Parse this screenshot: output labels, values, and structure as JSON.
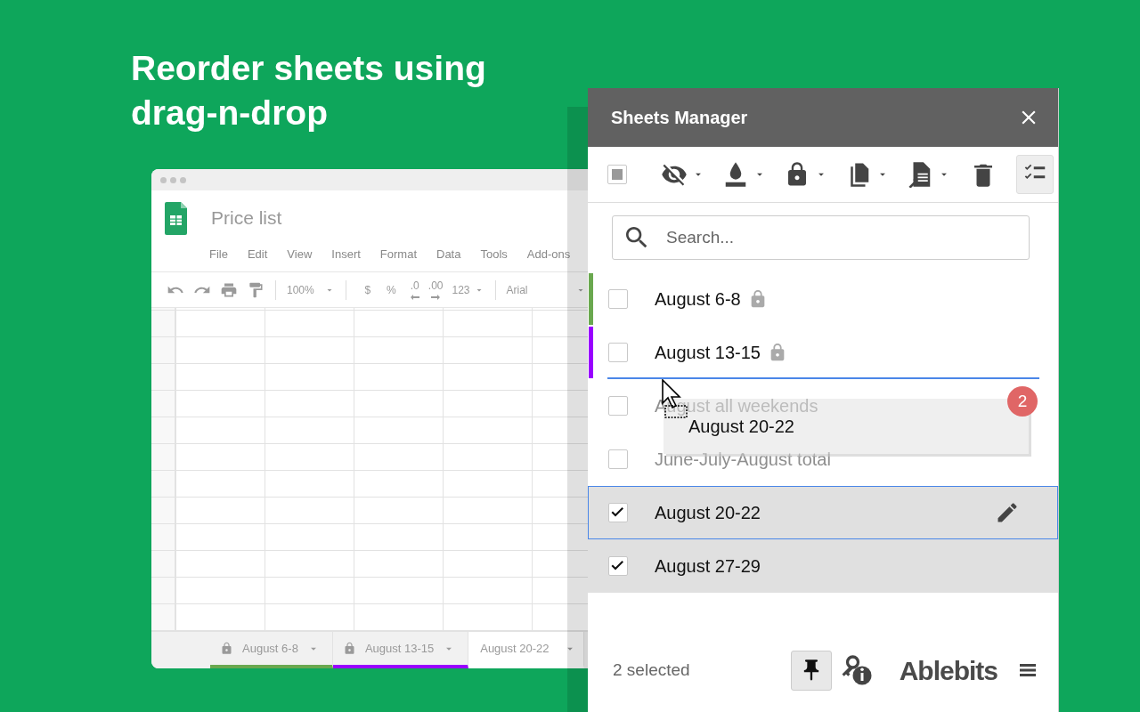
{
  "headline": "Reorder sheets using drag-n-drop",
  "spreadsheet": {
    "title": "Price list",
    "menu": [
      "File",
      "Edit",
      "View",
      "Insert",
      "Format",
      "Data",
      "Tools",
      "Add-ons"
    ],
    "toolbar": {
      "zoom": "100%",
      "currency": "$",
      "percent": "%",
      "decrease_decimals": ".0",
      "increase_decimals": ".00",
      "number_format": "123",
      "font": "Arial"
    },
    "tabs": [
      {
        "label": "August 6-8",
        "locked": true,
        "color": "#6aa84f",
        "selected": false
      },
      {
        "label": "August 13-15",
        "locked": true,
        "color": "#9900ff",
        "selected": false
      },
      {
        "label": "August 20-22",
        "locked": false,
        "selected": true
      }
    ]
  },
  "panel": {
    "title": "Sheets Manager",
    "select_all": {
      "partial": true
    },
    "search": {
      "placeholder": "Search..."
    },
    "sheets": [
      {
        "label": "August 6-8",
        "checked": false,
        "locked": true,
        "hidden": false,
        "selected": false,
        "color": "#6aa84f"
      },
      {
        "label": "August 13-15",
        "checked": false,
        "locked": true,
        "hidden": false,
        "selected": false,
        "color": "#9900ff"
      },
      {
        "label": "August all weekends",
        "checked": false,
        "locked": false,
        "hidden": true,
        "selected": false
      },
      {
        "label": "June-July-August total",
        "checked": false,
        "locked": false,
        "hidden": true,
        "selected": false
      },
      {
        "label": "August 20-22",
        "checked": true,
        "locked": false,
        "hidden": false,
        "selected": true
      },
      {
        "label": "August 27-29",
        "checked": true,
        "locked": false,
        "hidden": false,
        "selected": false
      }
    ],
    "drag": {
      "label": "August 20-22",
      "count": "2"
    },
    "footer": {
      "status": "2 selected",
      "pinned": true,
      "brand": "Ablebits"
    }
  }
}
